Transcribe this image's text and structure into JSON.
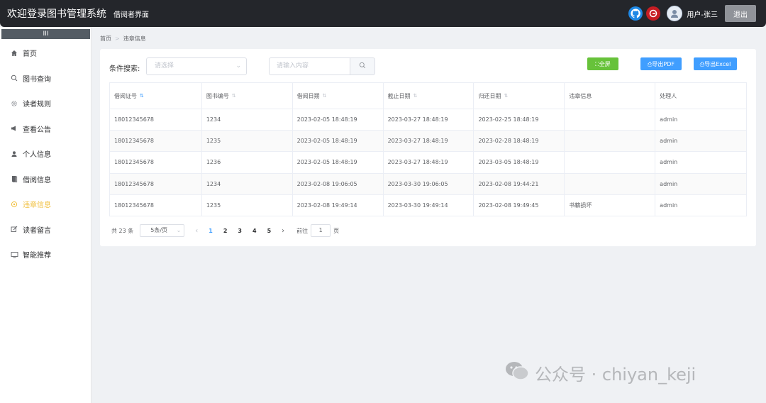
{
  "header": {
    "title": "欢迎登录图书管理系统",
    "subtitle": "借阅者界面",
    "github_icon": "github-icon",
    "gitee_icon": "gitee-icon",
    "user_label": "用户-张三",
    "logout_label": "退出"
  },
  "sidebar": {
    "collapse_label": "III",
    "items": [
      {
        "label": "首页",
        "icon": "home-icon"
      },
      {
        "label": "图书查询",
        "icon": "search-icon"
      },
      {
        "label": "读者规则",
        "icon": "gear-icon"
      },
      {
        "label": "查看公告",
        "icon": "megaphone-icon"
      },
      {
        "label": "个人信息",
        "icon": "user-icon"
      },
      {
        "label": "借阅信息",
        "icon": "document-icon"
      },
      {
        "label": "违章信息",
        "icon": "warning-icon"
      },
      {
        "label": "读者留言",
        "icon": "edit-icon"
      },
      {
        "label": "智能推荐",
        "icon": "monitor-icon"
      }
    ],
    "active_index": 6,
    "active_color": "#f0c040"
  },
  "breadcrumb": {
    "home": "首页",
    "current": "违章信息"
  },
  "filter": {
    "label": "条件搜索:",
    "select_placeholder": "请选择",
    "input_placeholder": "请输入内容"
  },
  "actions": {
    "fullscreen": "⛶全屏",
    "export_pdf": "⎙导出PDF",
    "export_excel": "⎙导出Excel"
  },
  "table": {
    "headers": [
      "借阅证号",
      "图书编号",
      "借阅日期",
      "截止日期",
      "归还日期",
      "违章信息",
      "处理人"
    ],
    "rows": [
      [
        "18012345678",
        "1234",
        "2023-02-05 18:48:19",
        "2023-03-27 18:48:19",
        "2023-02-25 18:48:19",
        "",
        "admin"
      ],
      [
        "18012345678",
        "1235",
        "2023-02-05 18:48:19",
        "2023-03-27 18:48:19",
        "2023-02-28 18:48:19",
        "",
        "admin"
      ],
      [
        "18012345678",
        "1236",
        "2023-02-05 18:48:19",
        "2023-03-27 18:48:19",
        "2023-03-05 18:48:19",
        "",
        "admin"
      ],
      [
        "18012345678",
        "1234",
        "2023-02-08 19:06:05",
        "2023-03-30 19:06:05",
        "2023-02-08 19:44:21",
        "",
        "admin"
      ],
      [
        "18012345678",
        "1235",
        "2023-02-08 19:49:14",
        "2023-03-30 19:49:14",
        "2023-02-08 19:49:45",
        "书籍损坏",
        "admin"
      ]
    ]
  },
  "pagination": {
    "total": "共 23 条",
    "page_size": "5条/页",
    "pages": [
      "1",
      "2",
      "3",
      "4",
      "5"
    ],
    "current_page": "1",
    "goto_prefix": "前往",
    "goto_value": "1",
    "goto_suffix": "页"
  },
  "watermark": "公众号 · chiyan_keji",
  "colors": {
    "primary": "#409eff",
    "success": "#67c23a",
    "header_bg": "#24262b"
  }
}
